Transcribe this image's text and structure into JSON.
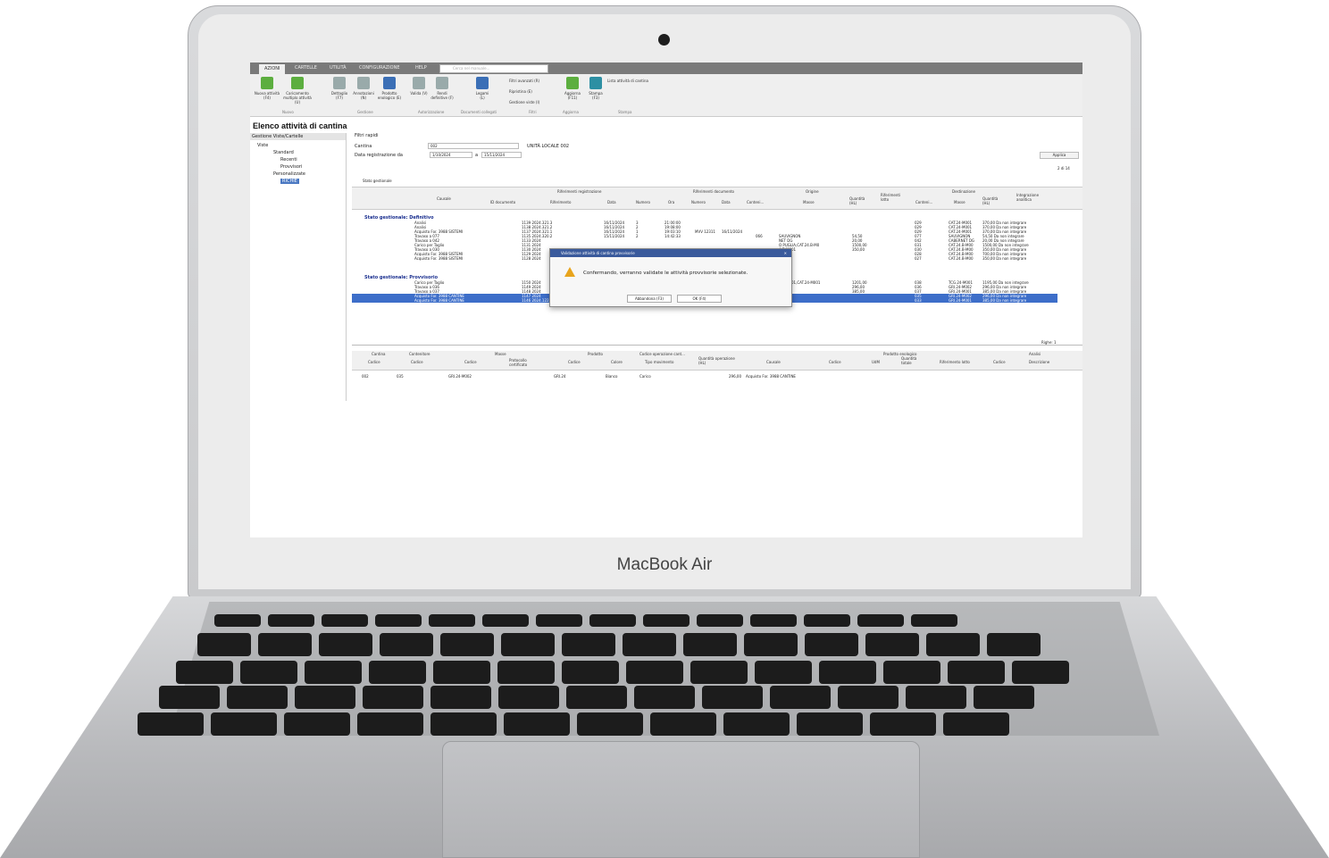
{
  "device": {
    "brand": "MacBook Air"
  },
  "app": {
    "tabs": [
      "AZIONI",
      "CARTELLE",
      "UTILITÀ",
      "CONFIGURAZIONE",
      "HELP"
    ],
    "search_placeholder": "Cerca nel manuale...",
    "ribbon": {
      "buttons": [
        {
          "label": "Nuova attività (F4)",
          "icon": "new-activity-icon"
        },
        {
          "label": "Caricamento multiplo attività (U)",
          "icon": "multi-load-icon"
        },
        {
          "label": "Dettaglio (F7)",
          "icon": "detail-icon"
        },
        {
          "label": "Annotazioni (N)",
          "icon": "notes-icon"
        },
        {
          "label": "Prodotto enologico (E)",
          "icon": "product-icon"
        },
        {
          "label": "Valida (V)",
          "icon": "validate-icon"
        },
        {
          "label": "Rendi definitive (F)",
          "icon": "make-final-icon"
        },
        {
          "label": "Legami (L)",
          "icon": "links-icon"
        },
        {
          "label": "Aggiorna (F11)",
          "icon": "refresh-icon"
        },
        {
          "label": "Stampa (F3)",
          "icon": "print-icon"
        }
      ],
      "filters": [
        "Filtri avanzati (R)",
        "Ripristina (E)",
        "Gestione viste (I)"
      ],
      "print_list": "Lista attività di cantina",
      "groups": [
        "Nuovo",
        "Gestione",
        "Autorizzazione",
        "Documenti collegati",
        "Filtri",
        "Aggiorna",
        "Stampa"
      ]
    },
    "page_title": "Elenco attività di cantina",
    "left_header": "Gestione Viste/Cartelle",
    "tree": [
      "Viste",
      "Standard",
      "Recenti",
      "Provvisori",
      "Personalizzate",
      "RICHIE"
    ],
    "quick_filters": "Filtri rapidi",
    "cantina_label": "Cantina",
    "cantina_value": "002",
    "unita": "UNITÀ LOCALE 002",
    "data_label": "Data registrazione da",
    "date_from": "1/10/2024",
    "date_to": "15/11/2024",
    "a_label": "a",
    "apply": "Applica",
    "count": "2 di 14",
    "stato_label": "Stato gestionale",
    "head_groups": [
      "Riferimenti registrazione",
      "Riferimenti documento",
      "Origine",
      "Destinazione"
    ],
    "columns": [
      "Causale",
      "ID documento",
      "Riferimento",
      "Data",
      "Numero",
      "Ora",
      "Numero",
      "Data",
      "Conteni...",
      "Masse",
      "Quantità (HL)",
      "Riferimenti lotto",
      "Conteni...",
      "Masse",
      "Quantità (HL)",
      "Integrazione analitica"
    ],
    "group_def": "Stato gestionale: Definitivo",
    "group_prov": "Stato gestionale: Provvisorio",
    "rows_def": [
      [
        "Analisi",
        "1139 2024.321.3",
        "16/11/2024",
        "3",
        "21:00:00",
        "",
        "",
        "",
        "",
        "",
        "029",
        "CAT.24-M001",
        "370,00 Da non integrare"
      ],
      [
        "Analisi",
        "1138 2024.321.2",
        "16/11/2024",
        "2",
        "19:08:00",
        "",
        "",
        "",
        "",
        "",
        "029",
        "CAT.24-M001",
        "370,00 Da non integrare"
      ],
      [
        "Acquisto For. 3988 SISTEMI",
        "1137 2024.321.1",
        "16/11/2024",
        "1",
        "19:03:10",
        "MVV 12311",
        "16/11/2024",
        "",
        "",
        "",
        "029",
        "CAT.24-M001",
        "370,00 Da non integrare"
      ],
      [
        "Travaso a 077",
        "1135 2024.320.2",
        "15/11/2024",
        "2",
        "14:42:33",
        "",
        "",
        "066",
        "SAUVIGNON",
        "54,50",
        "077",
        "SAUVIGNON",
        "54,50 Da non integrare"
      ],
      [
        "Travaso a 042",
        "1133 2024",
        "",
        "",
        "",
        "",
        "",
        "",
        "NET DG",
        "20,00",
        "042",
        "CABERNET DG",
        "20,00 Da non integrare"
      ],
      [
        "Carico per Taglio",
        "1131 2024",
        "",
        "",
        "",
        "",
        "",
        "",
        "O PUGLIA,CAT.24.B-M0",
        "1500,00",
        "031",
        "CAT.24.B-M00",
        "1500,00 Da non integrare"
      ],
      [
        "Travaso a 030",
        "1130 2024",
        "",
        "",
        "",
        "",
        "",
        "",
        "4.B-M001",
        "350,00",
        "030",
        "CAT.24.B-M00",
        "350,00 Da non integrare"
      ],
      [
        "Acquisto For. 3988 SISTEMI",
        "1129 2024",
        "",
        "",
        "",
        "",
        "",
        "",
        "",
        "",
        "028",
        "CAT.24.B-M00",
        "700,00 Da non integrare"
      ],
      [
        "Acquisto For. 3988 SISTEMI",
        "1128 2024",
        "",
        "",
        "",
        "",
        "",
        "",
        "",
        "",
        "027",
        "CAT.24.B-M00",
        "350,00 Da non integrare"
      ]
    ],
    "rows_prov": [
      [
        "Carico per Taglio",
        "1150 2024",
        "",
        "",
        "",
        "",
        "",
        "",
        "4.B-M001,CAT.24-M001",
        "1201,00",
        "038",
        "TCG.24-M001",
        "1195,00 Da non integrare"
      ],
      [
        "Travaso a 036",
        "1149 2024",
        "",
        "",
        "",
        "",
        "",
        "",
        "4-M002",
        "296,00",
        "036",
        "GRI.24-M002",
        "296,00 Da non integrare"
      ],
      [
        "Travaso a 037",
        "1148 2024",
        "",
        "",
        "",
        "",
        "",
        "",
        "4-M001",
        "385,00",
        "037",
        "GRI.24-M001",
        "385,00 Da non integrare"
      ],
      [
        "Acquisto For. 3988 CANTINE",
        "1147 2024",
        "",
        "",
        "",
        "",
        "",
        "",
        "",
        "",
        "035",
        "GRI.24-M002",
        "296,00 Da non integrare"
      ],
      [
        "Acquisto For. 3988 CANTINE",
        "1146 2024.1223.110724",
        "18/11/2024",
        "",
        "110724",
        "13:57:24",
        "",
        "",
        "",
        "",
        "033",
        "GRI.24-M001",
        "385,00 Da non integrare"
      ]
    ],
    "dialog": {
      "title": "Validazione attività di cantina provvisorie",
      "message": "Confermando, verranno validate le attività provvisorie selezionate.",
      "cancel": "Abbandona (F3)",
      "ok": "OK (F4)"
    },
    "detail": {
      "righe": "Righe: 1",
      "head_groups": [
        "Cantina",
        "Contenitore",
        "Masse",
        "Prodotto",
        "Codice operazione cant...",
        "Prodotto enologico",
        "Analisi"
      ],
      "columns": [
        "Codice",
        "Codice",
        "Codice",
        "Protocollo certificato",
        "Codice",
        "Colore",
        "Tipo movimento",
        "Quantità operazione (HL)",
        "Causale",
        "Codice",
        "UdM",
        "Quantità totale",
        "Riferimento lotto",
        "Codice",
        "Descrizione"
      ],
      "row": [
        "002",
        "035",
        "GRI.24-M002",
        "",
        "GRI.24",
        "Bianco",
        "Carico",
        "296,00",
        "Acquisto For. 3988 CANTINE"
      ]
    }
  }
}
